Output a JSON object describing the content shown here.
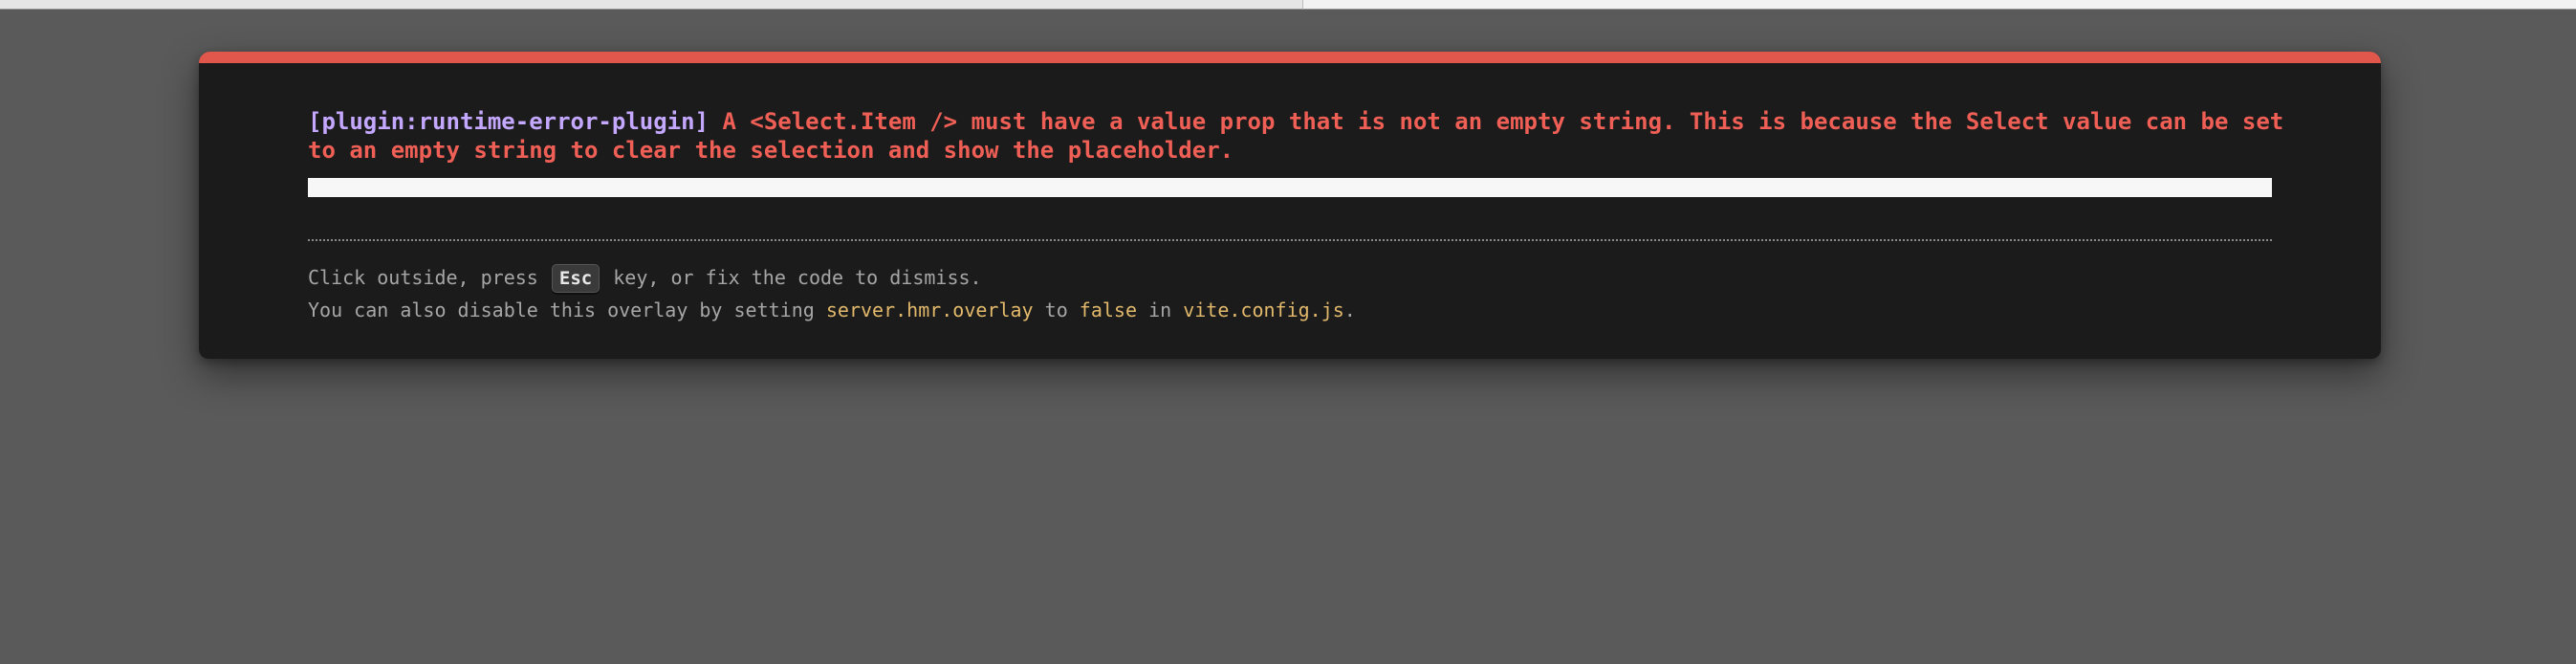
{
  "error_overlay": {
    "plugin": "[plugin:runtime-error-plugin]",
    "message": "A <Select.Item /> must have a value prop that is not an empty string. This is because the Select value can be set to an empty string to clear the selection and show the placeholder.",
    "tip_line1": {
      "before": "Click outside, press",
      "key": "Esc",
      "after": "key, or fix the code to dismiss."
    },
    "tip_line2": {
      "before": "You can also disable this overlay by setting",
      "setting": "server.hmr.overlay",
      "middle": "to",
      "value": "false",
      "in_text": "in",
      "file": "vite.config.js",
      "end": "."
    }
  },
  "colors": {
    "accent_bar": "#e2574c",
    "message": "#ef5f56",
    "plugin": "#c4a8ff",
    "code": "#e2b86b",
    "panel": "#1b1b1b",
    "backdrop": "#5a5a5a"
  }
}
